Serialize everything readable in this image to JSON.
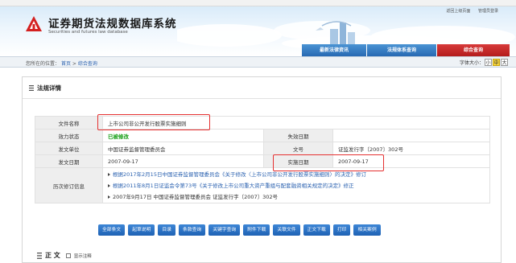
{
  "bookmarks": [],
  "header": {
    "title": "证券期货法规数据库系统",
    "subtitle": "Securities and futures law database",
    "top_links": [
      "返回上级页面",
      "管理员登录"
    ]
  },
  "nav": {
    "tabs": [
      {
        "label": "最新法律资讯"
      },
      {
        "label": "法规体系查询"
      },
      {
        "label": "综合查询"
      }
    ]
  },
  "breadcrumb": {
    "prefix": "您所在的位置：",
    "home": "首页",
    "sep": ">",
    "current": "综合查询",
    "font_label": "字体大小：",
    "sizes": [
      "小",
      "中",
      "大"
    ]
  },
  "detail": {
    "heading": "法规详情",
    "doc_name_label": "文件名称",
    "doc_name": "上市公司非公开发行股票实施细则",
    "status_label": "效力状态",
    "status": "已被修改",
    "expiry_label": "失效日期",
    "expiry": "",
    "issuer_label": "发文单位",
    "issuer": "中国证券监督管理委员会",
    "docno_label": "文号",
    "docno": "证监发行字〔2007〕302号",
    "issue_date_label": "发文日期",
    "issue_date": "2007-09-17",
    "effective_label": "实施日期",
    "effective": "2007-09-17",
    "history_label": "历次修订信息",
    "history": [
      "根据2017年2月15日中国证券监督管理委员会《关于修改〈上市公司非公开发行股票实施细则〉的决定》修订",
      "根据2011年8月1日证监会令第73号《关于修改上市公司重大资产重组与配套融资相关规定的决定》修正",
      "2007年9月17日 中国证券监督管理委员会 证监发行字〔2007〕302号"
    ]
  },
  "buttons": [
    "全部条文",
    "起草说明",
    "目录",
    "条款查询",
    "关键字查询",
    "附件下载",
    "关联文件",
    "正文下载",
    "打印",
    "相关案例"
  ],
  "body_section": {
    "title": "正 文",
    "toggle_label": "显示注释"
  },
  "colors": {
    "nav_blue": "#2769b3",
    "nav_active": "#b41c1c",
    "link": "#2b62b0",
    "status_green": "#18a018",
    "highlight_red": "#e53030"
  }
}
